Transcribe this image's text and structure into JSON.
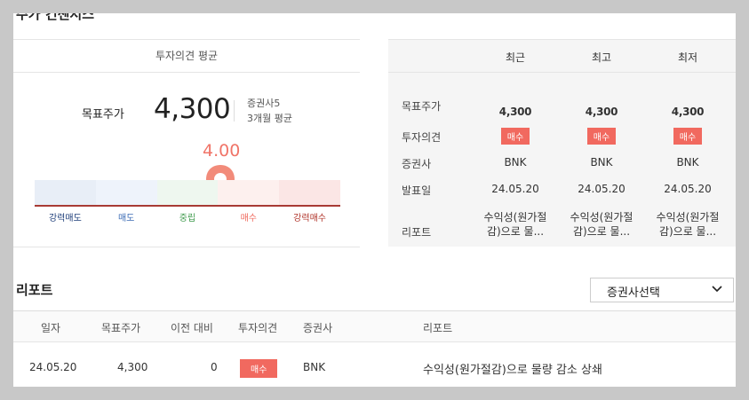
{
  "section_title": "주가 컨센서스",
  "left": {
    "header": "투자의견 평균",
    "target_label": "목표주가",
    "target_value": "4,300",
    "sub1": "증권사5",
    "sub2": "3개월 평균",
    "score": "4.00",
    "score_fraction": 0.6,
    "scale": [
      {
        "label": "강력매도",
        "color": "#1e3e7a",
        "bg": "#e8eef7"
      },
      {
        "label": "매도",
        "color": "#3b6bb5",
        "bg": "#eef3fb"
      },
      {
        "label": "중립",
        "color": "#3f9a4d",
        "bg": "#eef7ef"
      },
      {
        "label": "매수",
        "color": "#ef6a5e",
        "bg": "#fdf0ee"
      },
      {
        "label": "강력매수",
        "color": "#b0342a",
        "bg": "#fbe6e5"
      }
    ],
    "accent": "#f28b7a"
  },
  "right": {
    "columns": [
      "최근",
      "최고",
      "최저"
    ],
    "rows": {
      "target": "목표주가",
      "opinion": "투자의견",
      "broker": "증권사",
      "date": "발표일",
      "report": "리포트"
    },
    "cols": [
      {
        "target": "4,300",
        "opinion": "매수",
        "broker": "BNK",
        "date": "24.05.20",
        "report1": "수익성(원가절",
        "report2": "감)으로 물..."
      },
      {
        "target": "4,300",
        "opinion": "매수",
        "broker": "BNK",
        "date": "24.05.20",
        "report1": "수익성(원가절",
        "report2": "감)으로 물..."
      },
      {
        "target": "4,300",
        "opinion": "매수",
        "broker": "BNK",
        "date": "24.05.20",
        "report1": "수익성(원가절",
        "report2": "감)으로 물..."
      }
    ]
  },
  "report": {
    "title": "리포트",
    "select_label": "증권사선택",
    "headers": [
      "일자",
      "목표주가",
      "이전 대비",
      "투자의견",
      "증권사",
      "리포트"
    ],
    "rows": [
      {
        "date": "24.05.20",
        "target": "4,300",
        "change": "0",
        "opinion": "매수",
        "broker": "BNK",
        "report": "수익성(원가절감)으로 물량 감소 상쇄"
      }
    ]
  }
}
